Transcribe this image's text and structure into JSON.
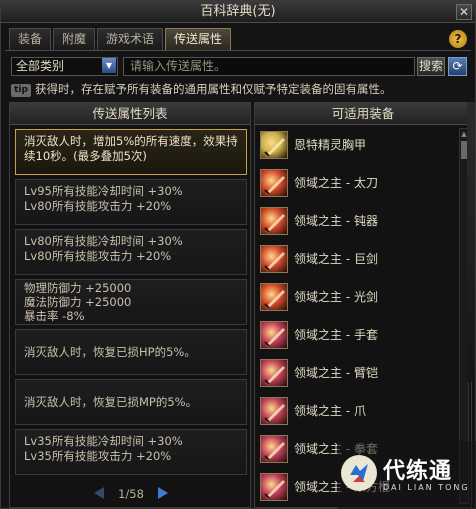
{
  "window": {
    "title": "百科辞典(无)",
    "close_glyph": "✕"
  },
  "tabs": [
    {
      "label": "装备",
      "active": false
    },
    {
      "label": "附魔",
      "active": false
    },
    {
      "label": "游戏术语",
      "active": false
    },
    {
      "label": "传送属性",
      "active": true
    }
  ],
  "help": {
    "glyph": "?"
  },
  "filter": {
    "category_value": "全部类别",
    "search_placeholder": "请输入传送属性。",
    "search_button": "搜索",
    "refresh_glyph": "⟳"
  },
  "tip": {
    "badge": "tip",
    "text": "获得时，存在赋予所有装备的通用属性和仅赋予特定装备的固有属性。"
  },
  "left_panel": {
    "header": "传送属性列表",
    "items": [
      {
        "lines": [
          "消灭敌人时，增加5%的所有速度，效果持续10秒。(最多叠加5次)"
        ],
        "selected": true
      },
      {
        "lines": [
          "Lv95所有技能冷却时间 +30%",
          "Lv80所有技能攻击力 +20%"
        ],
        "selected": false
      },
      {
        "lines": [
          "Lv80所有技能冷却时间 +30%",
          "Lv80所有技能攻击力 +20%"
        ],
        "selected": false
      },
      {
        "lines": [
          "物理防御力 +25000",
          "魔法防御力 +25000",
          "暴击率 -8%"
        ],
        "selected": false
      },
      {
        "lines": [
          "消灭敌人时，恢复已损HP的5%。"
        ],
        "selected": false
      },
      {
        "lines": [
          "消灭敌人时，恢复已损MP的5%。"
        ],
        "selected": false
      },
      {
        "lines": [
          "Lv35所有技能冷却时间 +30%",
          "Lv35所有技能攻击力 +20%"
        ],
        "selected": false
      }
    ],
    "pager": {
      "current": 1,
      "total": 58,
      "text": "1/58"
    }
  },
  "right_panel": {
    "header": "可适用装备",
    "items": [
      {
        "name": "恩特精灵胸甲",
        "icon": "chest-armor-icon",
        "color": "#c9b04a"
      },
      {
        "name": "领域之主 - 太刀",
        "icon": "katana-icon",
        "color": "#d04a2a"
      },
      {
        "name": "领域之主 - 钝器",
        "icon": "blunt-weapon-icon",
        "color": "#d04a2a"
      },
      {
        "name": "领域之主 - 巨剑",
        "icon": "greatsword-icon",
        "color": "#d04a2a"
      },
      {
        "name": "领域之主 - 光剑",
        "icon": "lightsaber-icon",
        "color": "#d04a2a"
      },
      {
        "name": "领域之主 - 手套",
        "icon": "gauntlet-icon",
        "color": "#c0405a"
      },
      {
        "name": "领域之主 - 臂铠",
        "icon": "arm-guard-icon",
        "color": "#c0405a"
      },
      {
        "name": "领域之主 - 爪",
        "icon": "claw-icon",
        "color": "#c0405a"
      },
      {
        "name": "领域之主 - 拳套",
        "icon": "knuckle-icon",
        "color": "#c0405a"
      },
      {
        "name": "领域之主 - 东方棍",
        "icon": "staff-icon",
        "color": "#c0405a"
      }
    ]
  },
  "watermark": {
    "text": "代练通",
    "sub": "DAI LIAN TONG"
  }
}
